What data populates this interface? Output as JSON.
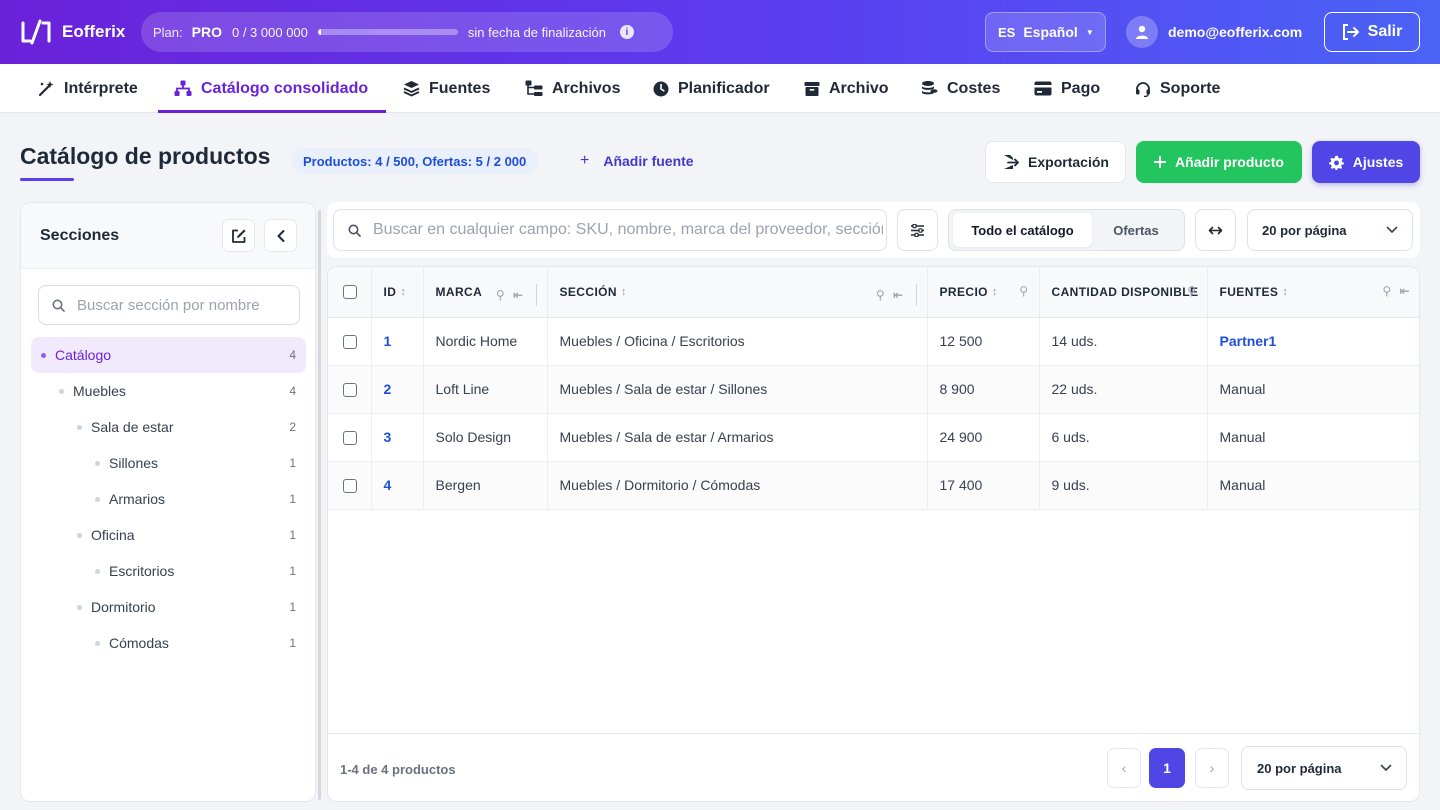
{
  "app": {
    "brand": "Eofferix",
    "plan_label": "Plan:",
    "plan_name": "PRO",
    "plan_usage": "0 / 3 000 000",
    "plan_progress": 0.02,
    "plan_end": "sin fecha de finalización",
    "lang_code": "ES",
    "lang_name": "Español",
    "user_email": "demo@eofferix.com",
    "logout_label": "Salir",
    "colors": {
      "brand_start": "#6a22d9",
      "brand_end": "#4a63f5",
      "accent": "#4f46e5",
      "success": "#22c55e",
      "link": "#1d4ed8"
    }
  },
  "nav": {
    "items": [
      {
        "label": "Intérprete",
        "icon": "magic-wand-icon"
      },
      {
        "label": "Catálogo consolidado",
        "icon": "sitemap-icon",
        "active": true
      },
      {
        "label": "Fuentes",
        "icon": "layers-icon"
      },
      {
        "label": "Archivos",
        "icon": "folder-tree-icon"
      },
      {
        "label": "Planificador",
        "icon": "clock-icon"
      },
      {
        "label": "Archivo",
        "icon": "archive-icon"
      },
      {
        "label": "Costes",
        "icon": "coins-icon"
      },
      {
        "label": "Pago",
        "icon": "credit-card-icon"
      },
      {
        "label": "Soporte",
        "icon": "headset-icon"
      }
    ]
  },
  "page": {
    "title": "Catálogo de productos",
    "counts": "Productos: 4 / 500, Ofertas: 5 / 2 000",
    "add_source": "Añadir fuente",
    "export_label": "Exportación",
    "add_product_label": "Añadir producto",
    "settings_label": "Ajustes"
  },
  "sidebar": {
    "title": "Secciones",
    "search_placeholder": "Buscar sección por nombre",
    "tree": [
      {
        "label": "Catálogo",
        "count": "4",
        "level": 0,
        "selected": true
      },
      {
        "label": "Muebles",
        "count": "4",
        "level": 1
      },
      {
        "label": "Sala de estar",
        "count": "2",
        "level": 2
      },
      {
        "label": "Sillones",
        "count": "1",
        "level": 3
      },
      {
        "label": "Armarios",
        "count": "1",
        "level": 3
      },
      {
        "label": "Oficina",
        "count": "1",
        "level": 2
      },
      {
        "label": "Escritorios",
        "count": "1",
        "level": 3
      },
      {
        "label": "Dormitorio",
        "count": "1",
        "level": 2
      },
      {
        "label": "Cómodas",
        "count": "1",
        "level": 3
      }
    ]
  },
  "toolbar": {
    "search_placeholder": "Buscar en cualquier campo: SKU, nombre, marca del proveedor, sección...",
    "seg_all": "Todo el catálogo",
    "seg_offers": "Ofertas",
    "per_page": "20 por página"
  },
  "table": {
    "columns": {
      "id": "ID",
      "brand": "MARCA",
      "section": "SECCIÓN",
      "price": "PRECIO",
      "qty": "CANTIDAD DISPONIBLE",
      "sources": "FUENTES"
    },
    "rows": [
      {
        "id": "1",
        "brand": "Nordic Home",
        "section": "Muebles / Oficina / Escritorios",
        "price": "12 500",
        "qty": "14 uds.",
        "source": "Partner1",
        "source_link": true
      },
      {
        "id": "2",
        "brand": "Loft Line",
        "section": "Muebles / Sala de estar / Sillones",
        "price": "8 900",
        "qty": "22 uds.",
        "source": "Manual"
      },
      {
        "id": "3",
        "brand": "Solo Design",
        "section": "Muebles / Sala de estar / Armarios",
        "price": "24 900",
        "qty": "6 uds.",
        "source": "Manual"
      },
      {
        "id": "4",
        "brand": "Bergen",
        "section": "Muebles / Dormitorio / Cómodas",
        "price": "17 400",
        "qty": "9 uds.",
        "source": "Manual"
      }
    ]
  },
  "footer": {
    "range": "1-4 de 4 productos",
    "prev": "‹",
    "page": "1",
    "next": "›",
    "per_page": "20 por página"
  }
}
